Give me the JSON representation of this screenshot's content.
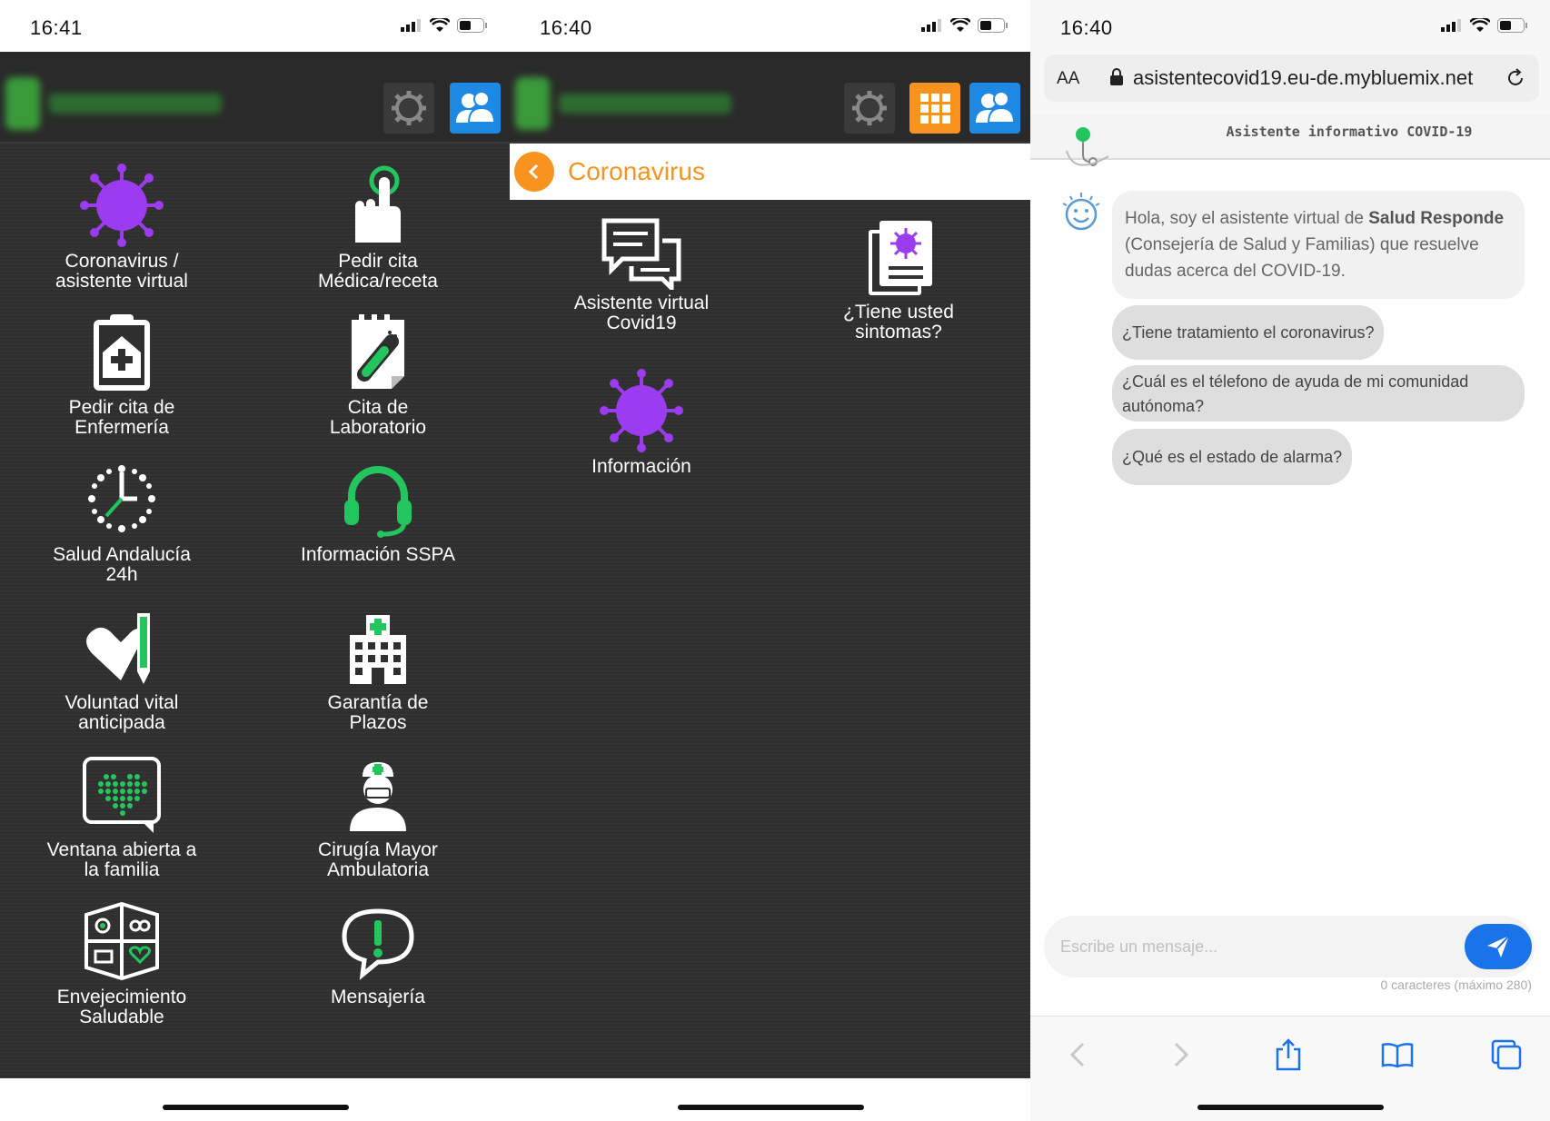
{
  "colors": {
    "accent_orange": "#f7931e",
    "accent_blue": "#1e88e5",
    "icon_green": "#22c55e",
    "virus_purple": "#9b3cf0",
    "dark_bg": "#2f2f2f"
  },
  "screen1": {
    "time": "16:41",
    "tiles": [
      {
        "label": "Coronavirus /\nasistente virtual",
        "icon": "virus-icon"
      },
      {
        "label": "Pedir cita\nMédica/receta",
        "icon": "hand-pointer-icon"
      },
      {
        "label": "Pedir cita de\nEnfermería",
        "icon": "clipboard-medical-icon"
      },
      {
        "label": "Cita de\nLaboratorio",
        "icon": "test-tube-icon"
      },
      {
        "label": "Salud Andalucía\n24h",
        "icon": "clock-icon"
      },
      {
        "label": "Información SSPA",
        "icon": "headset-icon"
      },
      {
        "label": "Voluntad vital\nanticipada",
        "icon": "heart-pen-icon"
      },
      {
        "label": "Garantía de\nPlazos",
        "icon": "hospital-icon"
      },
      {
        "label": "Ventana abierta a\nla familia",
        "icon": "screen-heart-icon"
      },
      {
        "label": "Cirugía Mayor\nAmbulatoria",
        "icon": "surgeon-icon"
      },
      {
        "label": "Envejecimiento\nSaludable",
        "icon": "aging-grid-icon"
      },
      {
        "label": "Mensajería",
        "icon": "chat-alert-icon"
      }
    ]
  },
  "screen2": {
    "time": "16:40",
    "title": "Coronavirus",
    "tiles": [
      {
        "label": "Asistente virtual\nCovid19",
        "icon": "chat-bubbles-icon"
      },
      {
        "label": "¿Tiene usted\nsintomas?",
        "icon": "virus-document-icon"
      },
      {
        "label": "Información",
        "icon": "virus-icon"
      }
    ]
  },
  "screen3": {
    "time": "16:40",
    "aa": "AA",
    "url": "asistentecovid19.eu-de.mybluemix.net",
    "chat_title": "Asistente informativo COVID-19",
    "bot_intro": "Hola, soy el asistente virtual de ",
    "bot_bold1": "Salud Responde",
    "bot_rest": " (Consejería de Salud y Familias) que resuelve dudas acerca del COVID-19.",
    "chips": [
      "¿Tiene tratamiento el coronavirus?",
      "¿Cuál es el télefono de ayuda de mi comunidad autónoma?",
      "¿Qué es el estado de alarma?"
    ],
    "input_placeholder": "Escribe un mensaje...",
    "counter": "0 caracteres (máximo 280)"
  }
}
